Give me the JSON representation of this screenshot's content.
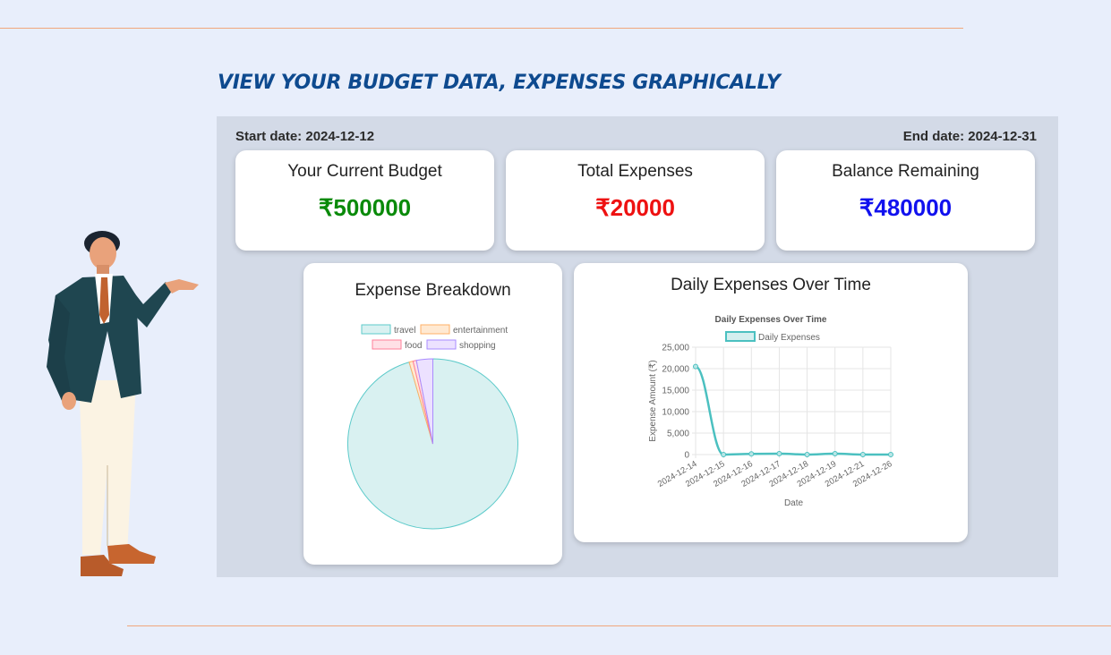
{
  "header": {
    "title": "VIEW YOUR BUDGET DATA, EXPENSES GRAPHICALLY"
  },
  "dates": {
    "start": "Start date: 2024-12-12",
    "end": "End date: 2024-12-31"
  },
  "stats": {
    "budget": {
      "label": "Your Current Budget",
      "value": "₹500000",
      "color": "#0a8a0a"
    },
    "expenses": {
      "label": "Total Expenses",
      "value": "₹20000",
      "color": "#ee1111"
    },
    "balance": {
      "label": "Balance Remaining",
      "value": "₹480000",
      "color": "#1111ee"
    }
  },
  "pie_card": {
    "title": "Expense Breakdown"
  },
  "line_card": {
    "title": "Daily Expenses Over Time"
  },
  "colors": {
    "accent_line": "#f0a77c",
    "title": "#0e4a8f",
    "panel": "#d3dae7"
  },
  "chart_data": [
    {
      "type": "pie",
      "title": "",
      "categories": [
        "travel",
        "entertainment",
        "food",
        "shopping"
      ],
      "values": [
        19100,
        150,
        130,
        620
      ],
      "colors": [
        "#d9f1f1",
        "#ffe9d2",
        "#ffe0e6",
        "#ece1ff"
      ],
      "borders": [
        "#5ccaca",
        "#ffb066",
        "#ff7f99",
        "#a98bff"
      ],
      "legend": "top"
    },
    {
      "type": "line",
      "title": "Daily Expenses Over Time",
      "xlabel": "Date",
      "ylabel": "Expense Amount (₹)",
      "x": [
        "2024-12-14",
        "2024-12-15",
        "2024-12-16",
        "2024-12-17",
        "2024-12-18",
        "2024-12-19",
        "2024-12-21",
        "2024-12-26"
      ],
      "series": [
        {
          "name": "Daily Expenses",
          "values": [
            20500,
            0,
            150,
            200,
            0,
            200,
            0,
            0
          ],
          "color": "#4bc0c0"
        }
      ],
      "ylim": [
        0,
        25000
      ],
      "yticks": [
        "0",
        "5,000",
        "10,000",
        "15,000",
        "20,000",
        "25,000"
      ],
      "grid": true,
      "legend": "top"
    }
  ]
}
